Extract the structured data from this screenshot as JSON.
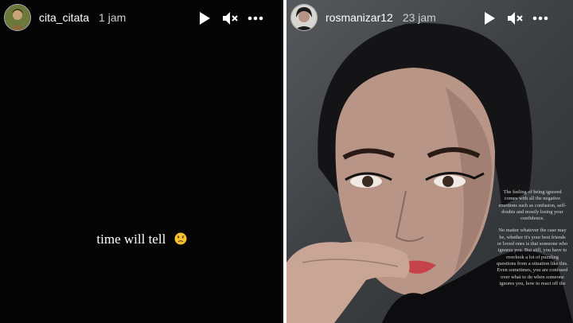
{
  "stories": [
    {
      "username": "cita_citata",
      "time": "1 jam",
      "caption": "time will tell",
      "caption_emoji": "sad-face-emoji"
    },
    {
      "username": "rosmanizar12",
      "time": "23 jam",
      "quote": [
        "The feeling of being ignored comes with all the negative emotions such as confusion, self-doubts and mostly losing your confidence.",
        "No matter whatever the case may be, whether it's your best friends or loved ones is that someone who ignores you. But still, you have to overlook a lot of puzzling questions from a situation like this. Even sometimes, you are confused over what to do when someone ignores you, how to react off the"
      ]
    }
  ],
  "icons": [
    "play-icon",
    "mute-icon",
    "more-icon"
  ],
  "colors": {
    "background": "#050505",
    "text": "#ffffff",
    "time": "#cfcfcf"
  }
}
